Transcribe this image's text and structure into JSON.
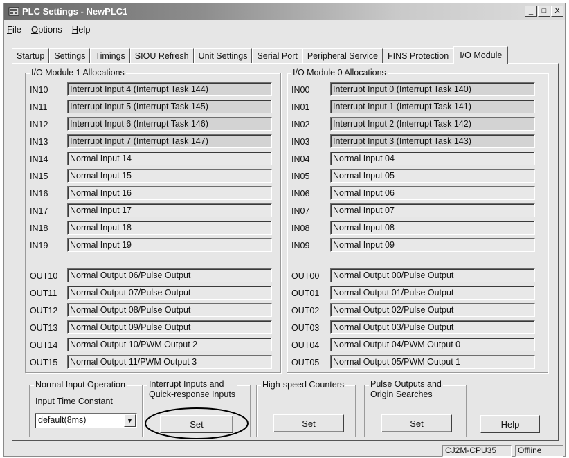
{
  "window": {
    "title": "PLC Settings - NewPLC1",
    "controls": [
      "_",
      "□",
      "X"
    ]
  },
  "menu": [
    {
      "label": "File",
      "accel": "F",
      "rest": "ile"
    },
    {
      "label": "Options",
      "accel": "O",
      "rest": "ptions"
    },
    {
      "label": "Help",
      "accel": "H",
      "rest": "elp"
    }
  ],
  "tabs": [
    "Startup",
    "Settings",
    "Timings",
    "SIOU Refresh",
    "Unit Settings",
    "Serial Port",
    "Peripheral Service",
    "FINS Protection",
    "I/O Module"
  ],
  "active_tab": "I/O Module",
  "module1": {
    "title": "I/O Module 1 Allocations",
    "inputs": [
      {
        "label": "IN10",
        "value": "Interrupt Input 4 (Interrupt Task 144)",
        "shaded": true
      },
      {
        "label": "IN11",
        "value": "Interrupt Input 5 (Interrupt Task 145)",
        "shaded": true
      },
      {
        "label": "IN12",
        "value": "Interrupt Input 6 (Interrupt Task 146)",
        "shaded": true
      },
      {
        "label": "IN13",
        "value": "Interrupt Input 7 (Interrupt Task 147)",
        "shaded": true
      },
      {
        "label": "IN14",
        "value": "Normal Input 14",
        "shaded": false
      },
      {
        "label": "IN15",
        "value": "Normal Input 15",
        "shaded": false
      },
      {
        "label": "IN16",
        "value": "Normal Input 16",
        "shaded": false
      },
      {
        "label": "IN17",
        "value": "Normal Input 17",
        "shaded": false
      },
      {
        "label": "IN18",
        "value": "Normal Input 18",
        "shaded": false
      },
      {
        "label": "IN19",
        "value": "Normal Input 19",
        "shaded": false
      }
    ],
    "outputs": [
      {
        "label": "OUT10",
        "value": "Normal Output 06/Pulse Output"
      },
      {
        "label": "OUT11",
        "value": "Normal Output 07/Pulse Output"
      },
      {
        "label": "OUT12",
        "value": "Normal Output 08/Pulse Output"
      },
      {
        "label": "OUT13",
        "value": "Normal Output 09/Pulse Output"
      },
      {
        "label": "OUT14",
        "value": "Normal Output 10/PWM Output 2"
      },
      {
        "label": "OUT15",
        "value": "Normal Output 11/PWM Output 3"
      }
    ]
  },
  "module0": {
    "title": "I/O Module 0 Allocations",
    "inputs": [
      {
        "label": "IN00",
        "value": "Interrupt Input 0 (Interrupt Task 140)",
        "shaded": true
      },
      {
        "label": "IN01",
        "value": "Interrupt Input 1 (Interrupt Task 141)",
        "shaded": true
      },
      {
        "label": "IN02",
        "value": "Interrupt Input 2 (Interrupt Task 142)",
        "shaded": true
      },
      {
        "label": "IN03",
        "value": "Interrupt Input 3 (Interrupt Task 143)",
        "shaded": true
      },
      {
        "label": "IN04",
        "value": "Normal Input 04",
        "shaded": false
      },
      {
        "label": "IN05",
        "value": "Normal Input 05",
        "shaded": false
      },
      {
        "label": "IN06",
        "value": "Normal Input 06",
        "shaded": false
      },
      {
        "label": "IN07",
        "value": "Normal Input 07",
        "shaded": false
      },
      {
        "label": "IN08",
        "value": "Normal Input 08",
        "shaded": false
      },
      {
        "label": "IN09",
        "value": "Normal Input 09",
        "shaded": false
      }
    ],
    "outputs": [
      {
        "label": "OUT00",
        "value": "Normal Output 00/Pulse Output"
      },
      {
        "label": "OUT01",
        "value": "Normal Output 01/Pulse Output"
      },
      {
        "label": "OUT02",
        "value": "Normal Output 02/Pulse Output"
      },
      {
        "label": "OUT03",
        "value": "Normal Output 03/Pulse Output"
      },
      {
        "label": "OUT04",
        "value": "Normal Output 04/PWM Output 0"
      },
      {
        "label": "OUT05",
        "value": "Normal Output 05/PWM Output 1"
      }
    ]
  },
  "normal_input": {
    "title": "Normal Input Operation",
    "label": "Input Time Constant",
    "value": "default(8ms)"
  },
  "interrupt": {
    "title_line1": "Interrupt Inputs and",
    "title_line2": "Quick-response Inputs",
    "button": "Set"
  },
  "hsc": {
    "title": "High-speed Counters",
    "button": "Set"
  },
  "pulse": {
    "title_line1": "Pulse Outputs and",
    "title_line2": "Origin Searches",
    "button": "Set"
  },
  "help_button": "Help",
  "status": {
    "model": "CJ2M-CPU35",
    "mode": "Offline"
  }
}
